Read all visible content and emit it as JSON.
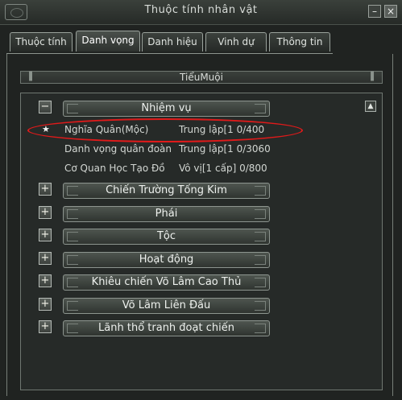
{
  "window": {
    "title": "Thuộc tính nhân vật",
    "close_label": "×"
  },
  "tabs": [
    {
      "label": "Thuộc tính",
      "active": false
    },
    {
      "label": "Danh vọng",
      "active": true
    },
    {
      "label": "Danh hiệu",
      "active": false
    },
    {
      "label": "Vinh dự",
      "active": false
    },
    {
      "label": "Thông tin",
      "active": false
    }
  ],
  "character_name": "TiểuMuội",
  "categories": [
    {
      "label": "Nhiệm vụ",
      "expanded": true,
      "children": [
        {
          "name": "Nghĩa Quân(Mộc)",
          "status": "Trung lập[1 0/400",
          "highlighted": true,
          "marker": "★"
        },
        {
          "name": "Danh vọng quân đoàn",
          "status": "Trung lập[1 0/3060",
          "highlighted": false,
          "marker": ""
        },
        {
          "name": "Cơ Quan Học Tạo Đồ",
          "status": "Vô vị[1 cấp] 0/800",
          "highlighted": false,
          "marker": ""
        }
      ]
    },
    {
      "label": "Chiến Trường Tống Kim",
      "expanded": false
    },
    {
      "label": "Phái",
      "expanded": false
    },
    {
      "label": "Tộc",
      "expanded": false
    },
    {
      "label": "Hoạt động",
      "expanded": false
    },
    {
      "label": "Khiêu chiến Võ Lâm Cao Thủ",
      "expanded": false
    },
    {
      "label": "Võ Lâm Liên Đấu",
      "expanded": false
    },
    {
      "label": "Lãnh thổ tranh đoạt chiến",
      "expanded": false
    }
  ],
  "toggle_symbols": {
    "expanded": "−",
    "collapsed": "+"
  },
  "colors": {
    "highlight": "#e01a1a",
    "panel_bg": "#202321"
  }
}
